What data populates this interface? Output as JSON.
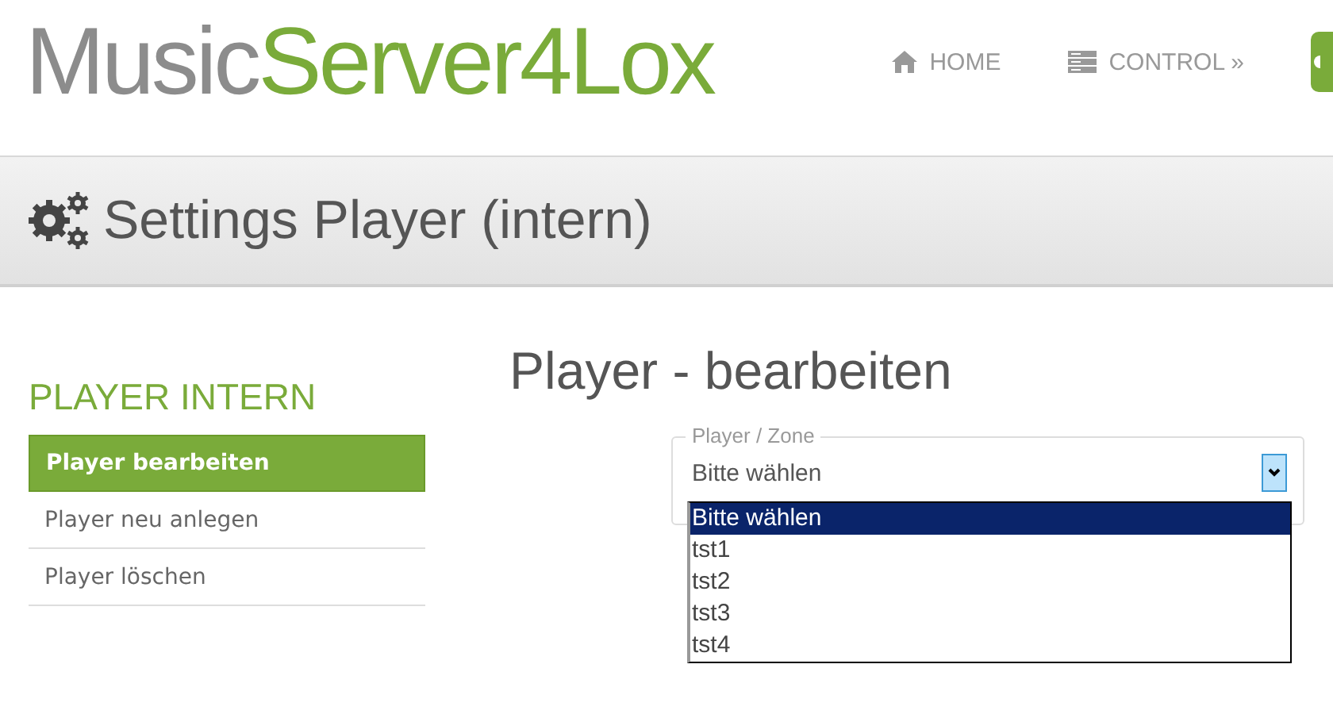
{
  "logo": {
    "first": "Music",
    "second": "Server4Lox"
  },
  "nav": [
    {
      "label": "HOME"
    },
    {
      "label": "CONTROL »"
    }
  ],
  "page_title": "Settings Player (intern)",
  "sidebar": {
    "heading": "PLAYER INTERN",
    "items": [
      {
        "label": "Player bearbeiten",
        "selected": true
      },
      {
        "label": "Player neu anlegen",
        "selected": false
      },
      {
        "label": "Player löschen",
        "selected": false
      }
    ]
  },
  "main": {
    "heading": "Player - bearbeiten",
    "field": {
      "legend": "Player / Zone",
      "value": "Bitte wählen",
      "expanded": true,
      "options": [
        {
          "label": "Bitte wählen",
          "selected": true
        },
        {
          "label": "tst1",
          "selected": false
        },
        {
          "label": "tst2",
          "selected": false
        },
        {
          "label": "tst3",
          "selected": false
        },
        {
          "label": "tst4",
          "selected": false
        }
      ]
    }
  }
}
